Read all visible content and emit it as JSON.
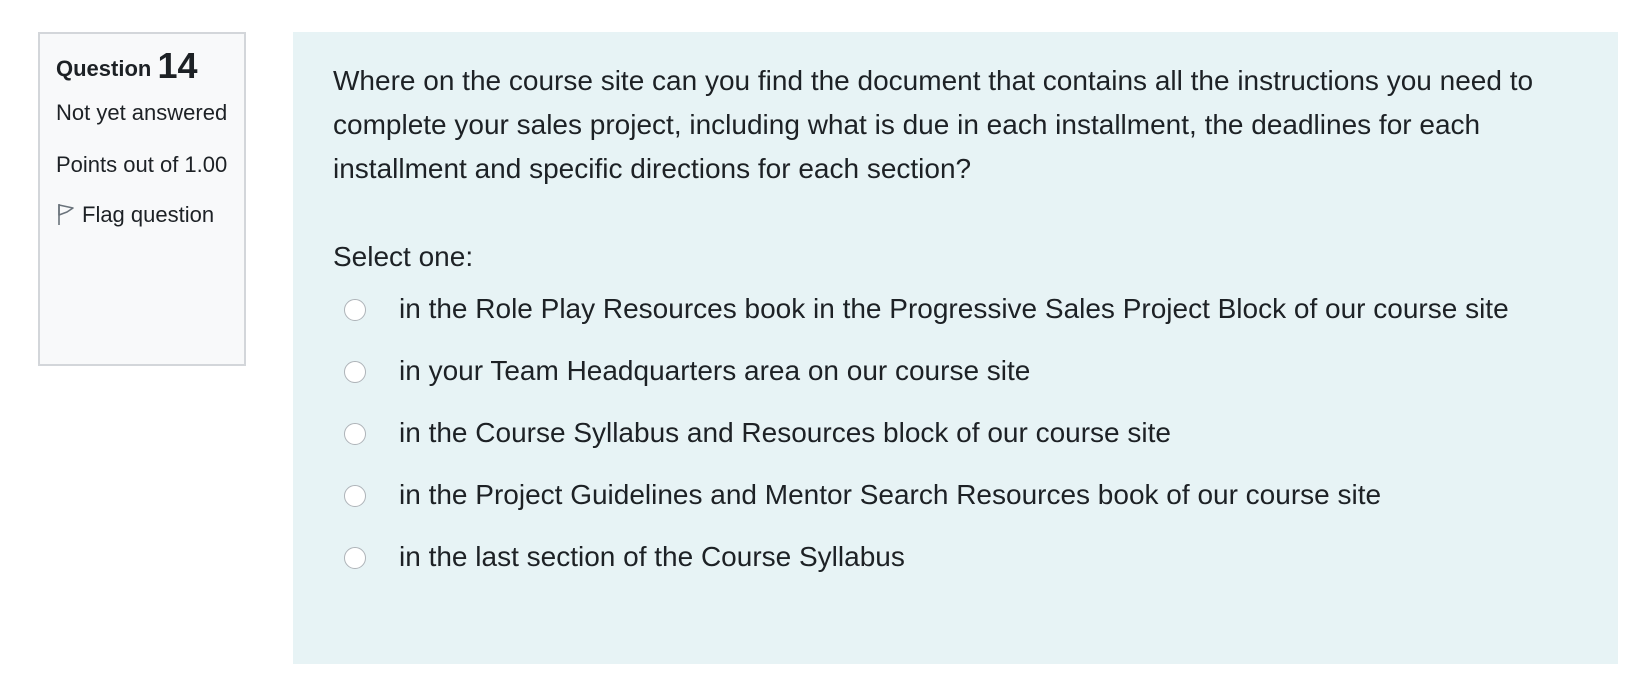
{
  "info": {
    "question_label": "Question",
    "question_number": "14",
    "state": "Not yet answered",
    "grade": "Points out of 1.00",
    "flag_label": "Flag question"
  },
  "question": {
    "text": "Where on the course site can you find the document that contains all the instructions you need to complete your sales project, including what is due in each installment, the deadlines for each installment and specific directions for each section?",
    "prompt": "Select one:",
    "options": [
      {
        "label": "in the Role Play Resources book in the Progressive Sales Project Block of our course site",
        "selected": false
      },
      {
        "label": "in your Team Headquarters area on our course site",
        "selected": false
      },
      {
        "label": "in the Course Syllabus and Resources block of our course site",
        "selected": false
      },
      {
        "label": "in the Project Guidelines and Mentor Search Resources book of our course site",
        "selected": false
      },
      {
        "label": "in the last section of the Course Syllabus",
        "selected": false
      }
    ]
  },
  "colors": {
    "content_bg": "#e7f3f5",
    "info_bg": "#f8f9fa",
    "info_border": "#d3d6da",
    "text": "#1d2125"
  },
  "icons": {
    "flag": "flag-icon"
  }
}
